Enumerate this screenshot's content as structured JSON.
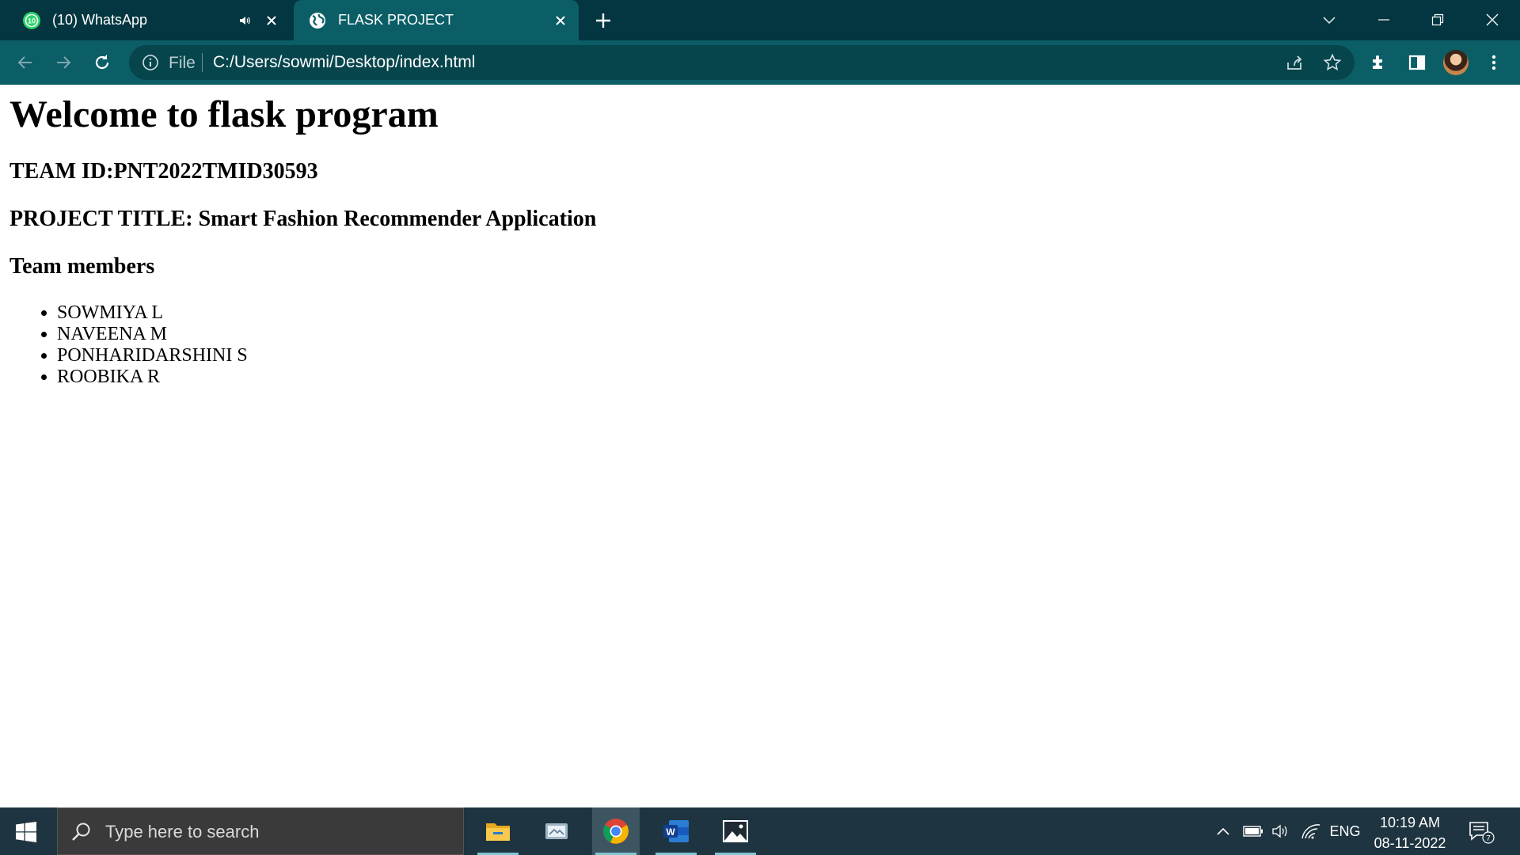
{
  "browser": {
    "tabs": [
      {
        "label": "(10) WhatsApp",
        "badge": "10",
        "active": false
      },
      {
        "label": "FLASK PROJECT",
        "active": true
      }
    ],
    "address": {
      "scheme_label": "File",
      "url": "C:/Users/sowmi/Desktop/index.html"
    },
    "colors": {
      "frame": "#033640",
      "toolbar": "#0b5e66",
      "omnibox": "#07454d"
    }
  },
  "page": {
    "heading": "Welcome to flask program",
    "team_id": "TEAM ID:PNT2022TMID30593",
    "project_title": "PROJECT TITLE: Smart Fashion Recommender Application",
    "members_heading": "Team members",
    "members": [
      "SOWMIYA L",
      "NAVEENA M",
      "PONHARIDARSHINI S",
      "ROOBIKA R"
    ]
  },
  "taskbar": {
    "search_placeholder": "Type here to search",
    "apps": [
      "file-explorer",
      "snip-tool",
      "chrome",
      "word",
      "photos"
    ],
    "language": "ENG",
    "time": "10:19 AM",
    "date": "08-11-2022",
    "notifications": "7"
  }
}
